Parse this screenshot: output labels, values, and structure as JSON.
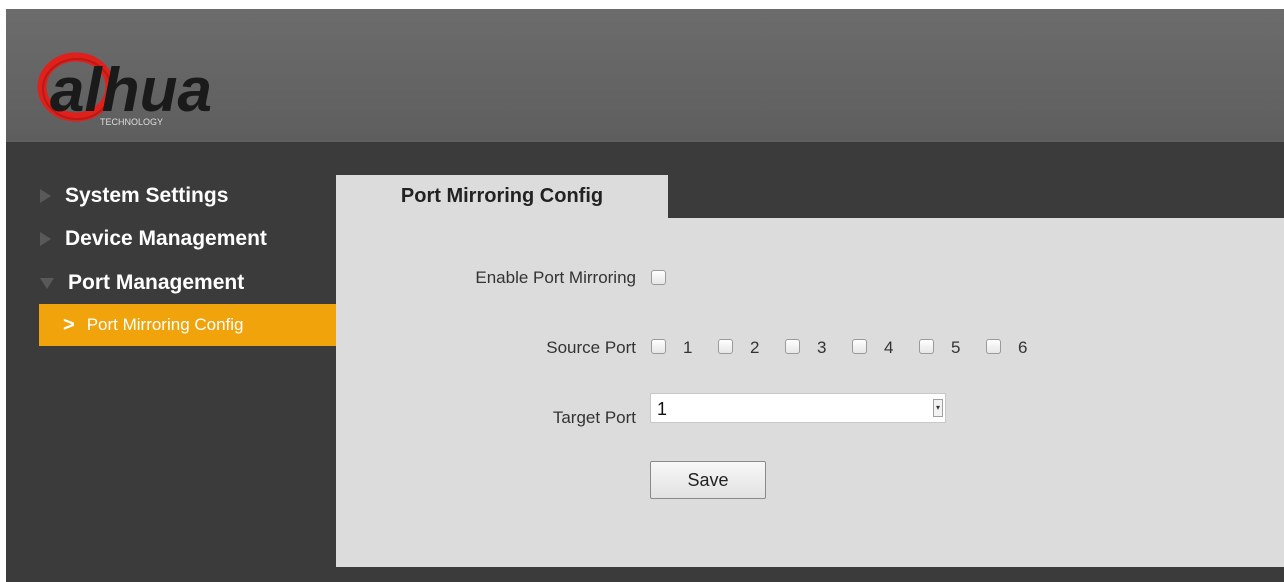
{
  "brand": {
    "name": "alhua",
    "tagline": "TECHNOLOGY",
    "accent": "#e0201b"
  },
  "sidebar": {
    "items": [
      {
        "label": "System Settings",
        "expanded": false
      },
      {
        "label": "Device Management",
        "expanded": false
      },
      {
        "label": "Port Management",
        "expanded": true
      }
    ],
    "active_sub": {
      "label": "Port Mirroring Config",
      "chevron": ">"
    },
    "active_color": "#f0a30a"
  },
  "main": {
    "tab": "Port Mirroring Config",
    "enable_label": "Enable Port Mirroring",
    "source_label": "Source Port",
    "source_ports": [
      "1",
      "2",
      "3",
      "4",
      "5",
      "6"
    ],
    "target_label": "Target Port",
    "target_value": "1",
    "save_label": "Save"
  }
}
